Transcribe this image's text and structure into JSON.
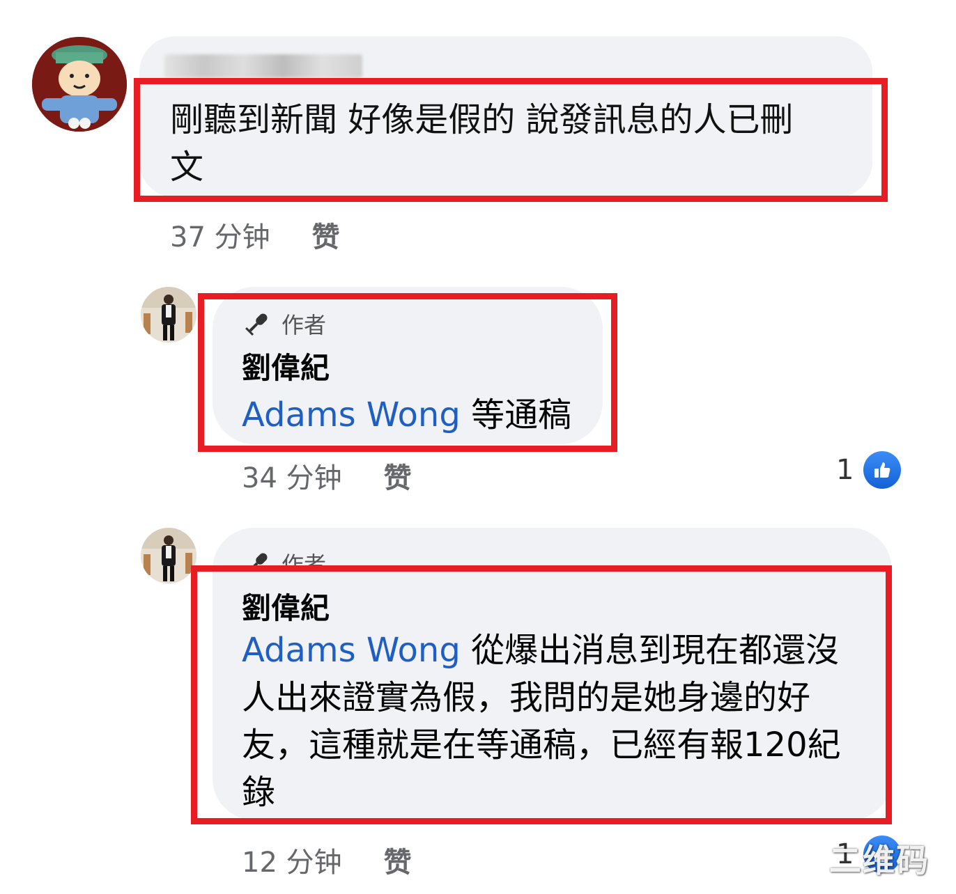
{
  "comments": [
    {
      "author": "",
      "text_line1": "剛聽到新聞 好像是假的 說發訊息的人已刪",
      "text_line2": "文",
      "time": "37 分钟",
      "like_label": "赞"
    },
    {
      "badge": "作者",
      "author": "劉偉紀",
      "mention": "Adams Wong",
      "text": " 等通稿",
      "time": "34 分钟",
      "like_label": "赞",
      "reaction_count": "1"
    },
    {
      "badge": "作者",
      "author": "劉偉紀",
      "mention": "Adams Wong",
      "text": " 從爆出消息到現在都還沒人出來證實為假，我問的是她身邊的好友，這種就是在等通稿，已經有報120紀錄",
      "time": "12 分钟",
      "like_label": "赞",
      "reaction_count": "1"
    }
  ],
  "watermark": "二维码",
  "colors": {
    "highlight_frame": "#e81d24",
    "bubble_bg": "#f0f2f5",
    "mention": "#1f5fc1",
    "like_blue": "#1877f2"
  },
  "icons": {
    "author_badge": "microphone-icon",
    "reaction": "thumbs-up-icon"
  }
}
